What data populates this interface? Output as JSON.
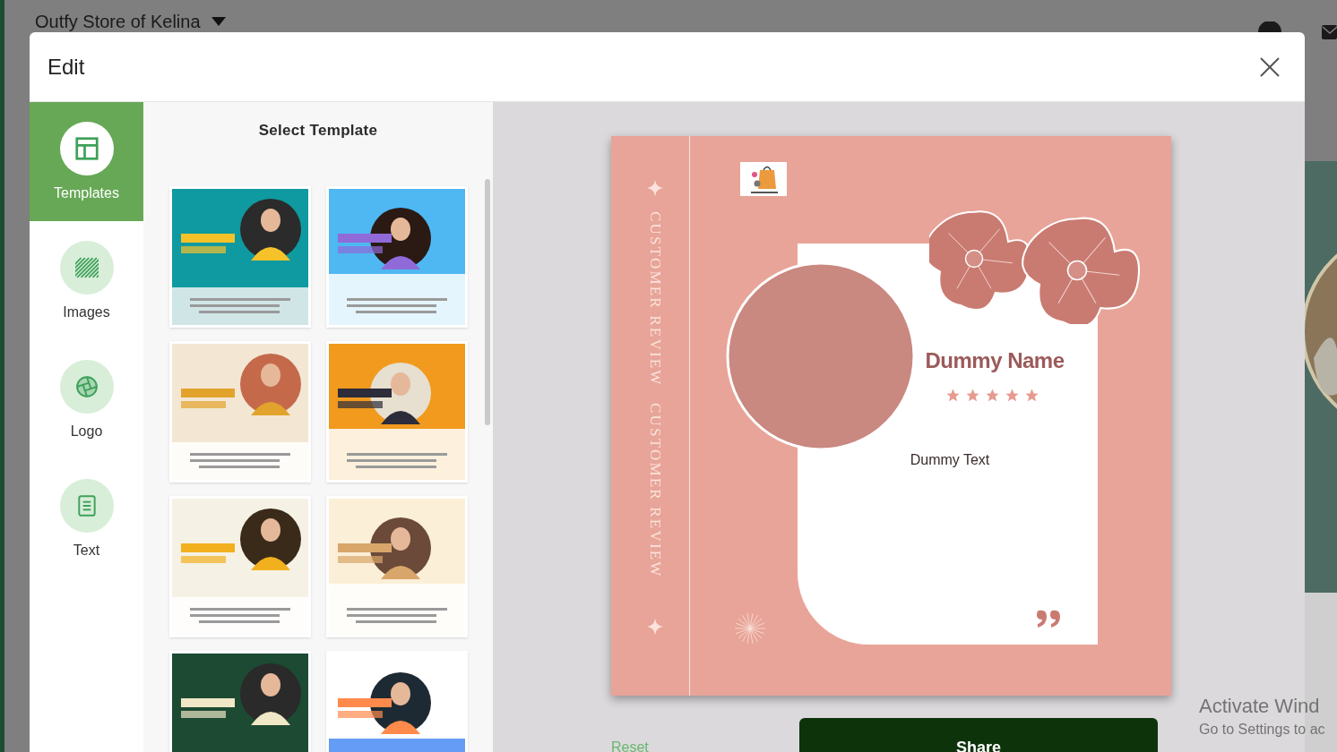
{
  "page_header": {
    "store_name": "Outfy Store of Kelina"
  },
  "dialog": {
    "title": "Edit"
  },
  "rail": [
    {
      "kind": "templates",
      "label": "Templates",
      "selected": true
    },
    {
      "kind": "images",
      "label": "Images",
      "selected": false
    },
    {
      "kind": "logo",
      "label": "Logo",
      "selected": false
    },
    {
      "kind": "text",
      "label": "Text",
      "selected": false
    }
  ],
  "template_panel": {
    "title": "Select Template"
  },
  "preview": {
    "side_texts": [
      "CUSTOMER REVIEW",
      "CUSTOMER REVIEW"
    ],
    "name": "Dummy Name",
    "stars": 5,
    "body": "Dummy Text"
  },
  "actions": {
    "reset": "Reset",
    "share": "Share"
  },
  "os_notice": {
    "title": "Activate Wind",
    "subtitle": "Go to Settings to ac"
  }
}
